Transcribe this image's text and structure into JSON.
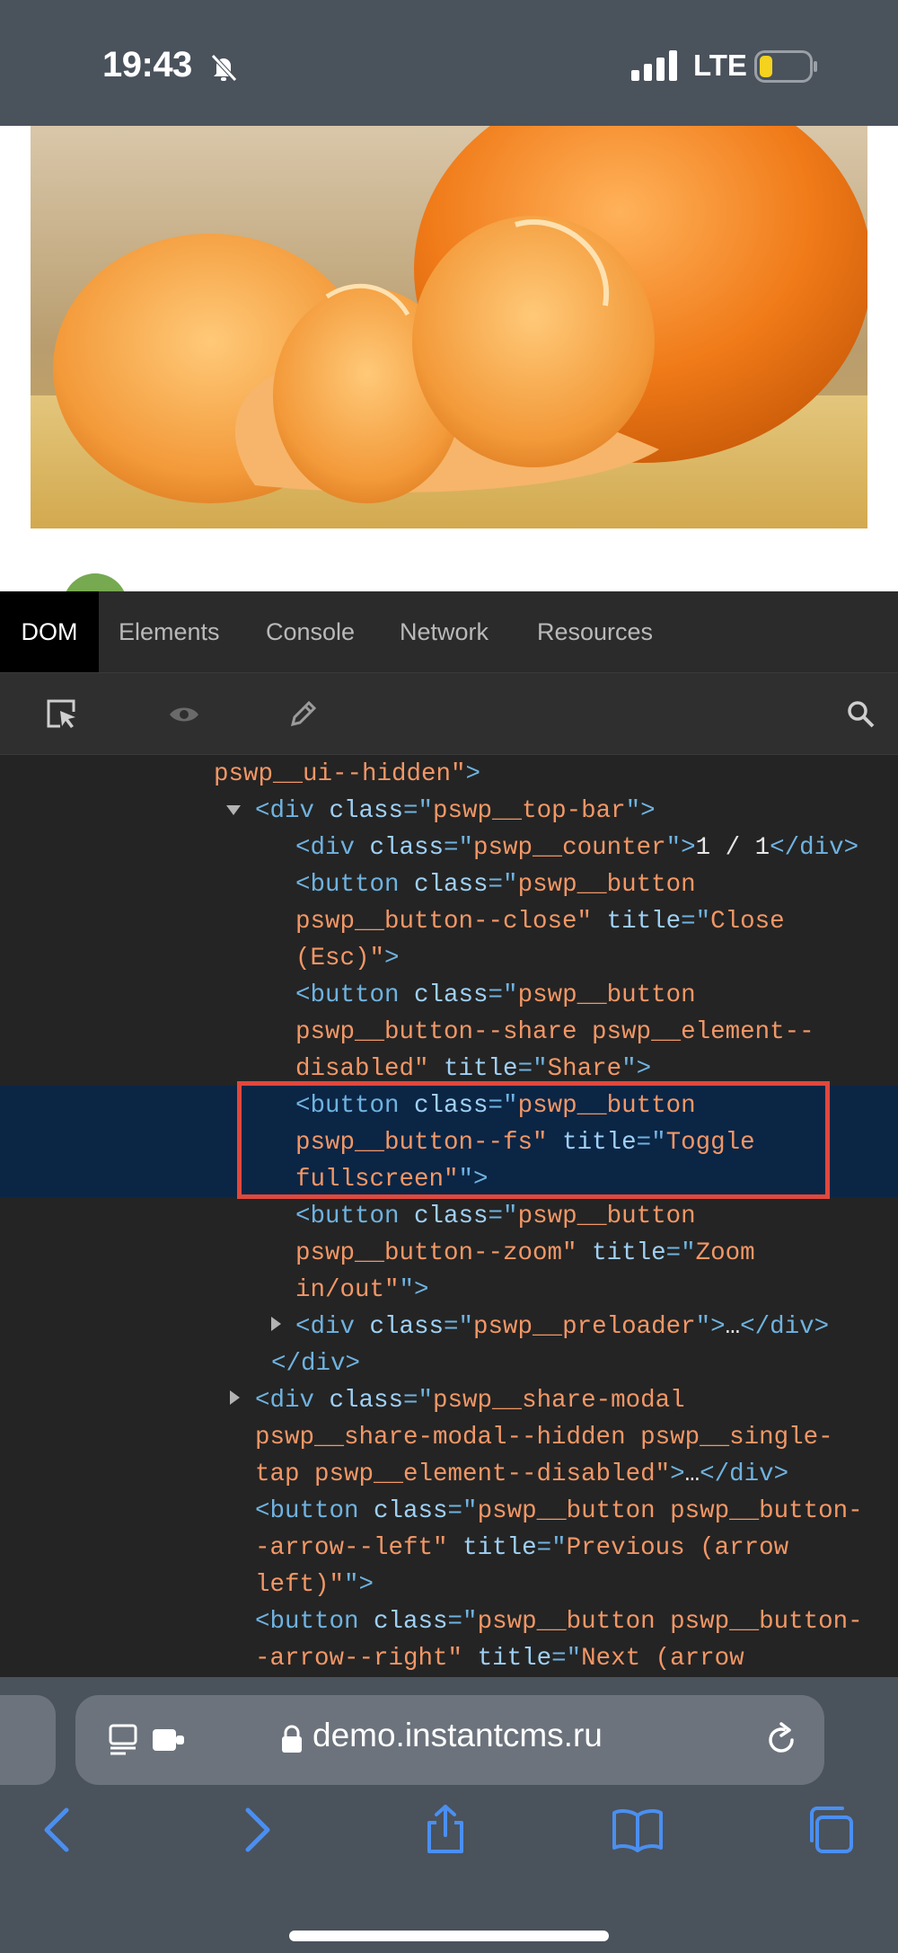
{
  "status_bar": {
    "time": "19:43",
    "network": "LTE",
    "battery_color": "#f5d21e"
  },
  "devtools": {
    "tabs": [
      {
        "label": "DOM",
        "active": true
      },
      {
        "label": "Elements",
        "active": false
      },
      {
        "label": "Console",
        "active": false
      },
      {
        "label": "Network",
        "active": false
      },
      {
        "label": "Resources",
        "active": false
      }
    ],
    "tools": [
      "select-element-icon",
      "eye-icon",
      "pencil-icon",
      "search-icon"
    ],
    "dom_lines": [
      {
        "parts": [
          [
            "v",
            "pswp__ui--hidden\""
          ],
          [
            "t",
            ">"
          ]
        ]
      },
      {
        "parts": [
          [
            "t",
            "<div "
          ],
          [
            "a",
            "class"
          ],
          [
            "t",
            "=\""
          ],
          [
            "v",
            "pswp__top-bar"
          ],
          [
            "t",
            "\">"
          ]
        ]
      },
      {
        "parts": [
          [
            "t",
            "<div "
          ],
          [
            "a",
            "class"
          ],
          [
            "t",
            "=\""
          ],
          [
            "v",
            "pswp__counter"
          ],
          [
            "t",
            "\">"
          ],
          [
            "x",
            "1 / 1"
          ],
          [
            "t",
            "</div>"
          ]
        ]
      },
      {
        "parts": [
          [
            "t",
            "<button "
          ],
          [
            "a",
            "class"
          ],
          [
            "t",
            "=\""
          ],
          [
            "v",
            "pswp__button"
          ]
        ]
      },
      {
        "parts": [
          [
            "v",
            "pswp__button--close\""
          ],
          [
            "t",
            " "
          ],
          [
            "a",
            "title"
          ],
          [
            "t",
            "=\""
          ],
          [
            "v",
            "Close"
          ]
        ]
      },
      {
        "parts": [
          [
            "v",
            "(Esc)\""
          ],
          [
            "t",
            ">"
          ]
        ]
      },
      {
        "parts": [
          [
            "t",
            "<button "
          ],
          [
            "a",
            "class"
          ],
          [
            "t",
            "=\""
          ],
          [
            "v",
            "pswp__button"
          ]
        ]
      },
      {
        "parts": [
          [
            "v",
            "pswp__button--share pswp__element--"
          ]
        ]
      },
      {
        "parts": [
          [
            "v",
            "disabled\""
          ],
          [
            "t",
            " "
          ],
          [
            "a",
            "title"
          ],
          [
            "t",
            "=\""
          ],
          [
            "v",
            "Share"
          ],
          [
            "t",
            "\">"
          ]
        ]
      },
      {
        "parts": [
          [
            "t",
            "<button "
          ],
          [
            "a",
            "class"
          ],
          [
            "t",
            "=\""
          ],
          [
            "v",
            "pswp__button"
          ]
        ]
      },
      {
        "parts": [
          [
            "v",
            "pswp__button--fs\""
          ],
          [
            "t",
            " "
          ],
          [
            "a",
            "title"
          ],
          [
            "t",
            "=\""
          ],
          [
            "v",
            "Toggle"
          ]
        ]
      },
      {
        "parts": [
          [
            "v",
            "fullscreen\""
          ],
          [
            "t",
            "\">"
          ]
        ]
      },
      {
        "parts": [
          [
            "t",
            "<button "
          ],
          [
            "a",
            "class"
          ],
          [
            "t",
            "=\""
          ],
          [
            "v",
            "pswp__button"
          ]
        ]
      },
      {
        "parts": [
          [
            "v",
            "pswp__button--zoom\""
          ],
          [
            "t",
            " "
          ],
          [
            "a",
            "title"
          ],
          [
            "t",
            "=\""
          ],
          [
            "v",
            "Zoom"
          ]
        ]
      },
      {
        "parts": [
          [
            "v",
            "in/out\""
          ],
          [
            "t",
            "\">"
          ]
        ]
      },
      {
        "parts": [
          [
            "t",
            "<div "
          ],
          [
            "a",
            "class"
          ],
          [
            "t",
            "=\""
          ],
          [
            "v",
            "pswp__preloader"
          ],
          [
            "t",
            "\">"
          ],
          [
            "x",
            "…"
          ],
          [
            "t",
            "</div>"
          ]
        ]
      },
      {
        "parts": [
          [
            "t",
            "</div>"
          ]
        ]
      },
      {
        "parts": [
          [
            "t",
            "<div "
          ],
          [
            "a",
            "class"
          ],
          [
            "t",
            "=\""
          ],
          [
            "v",
            "pswp__share-modal"
          ]
        ]
      },
      {
        "parts": [
          [
            "v",
            "pswp__share-modal--hidden pswp__single-"
          ]
        ]
      },
      {
        "parts": [
          [
            "v",
            "tap pswp__element--disabled\""
          ],
          [
            "t",
            ">"
          ],
          [
            "x",
            "…"
          ],
          [
            "t",
            "</div>"
          ]
        ]
      },
      {
        "parts": [
          [
            "t",
            "<button "
          ],
          [
            "a",
            "class"
          ],
          [
            "t",
            "=\""
          ],
          [
            "v",
            "pswp__button pswp__button-"
          ]
        ]
      },
      {
        "parts": [
          [
            "v",
            "-arrow--left\""
          ],
          [
            "t",
            " "
          ],
          [
            "a",
            "title"
          ],
          [
            "t",
            "=\""
          ],
          [
            "v",
            "Previous (arrow"
          ]
        ]
      },
      {
        "parts": [
          [
            "v",
            "left)\""
          ],
          [
            "t",
            "\">"
          ]
        ]
      },
      {
        "parts": [
          [
            "t",
            "<button "
          ],
          [
            "a",
            "class"
          ],
          [
            "t",
            "=\""
          ],
          [
            "v",
            "pswp__button pswp__button-"
          ]
        ]
      },
      {
        "parts": [
          [
            "v",
            "-arrow--right\""
          ],
          [
            "t",
            " "
          ],
          [
            "a",
            "title"
          ],
          [
            "t",
            "=\""
          ],
          [
            "v",
            "Next (arrow"
          ]
        ]
      }
    ]
  },
  "browser": {
    "url": "demo.instantcms.ru",
    "nav_icons": [
      "back-icon",
      "forward-icon",
      "share-icon",
      "bookmarks-icon",
      "tabs-icon"
    ],
    "accent": "#4a8ff0"
  }
}
